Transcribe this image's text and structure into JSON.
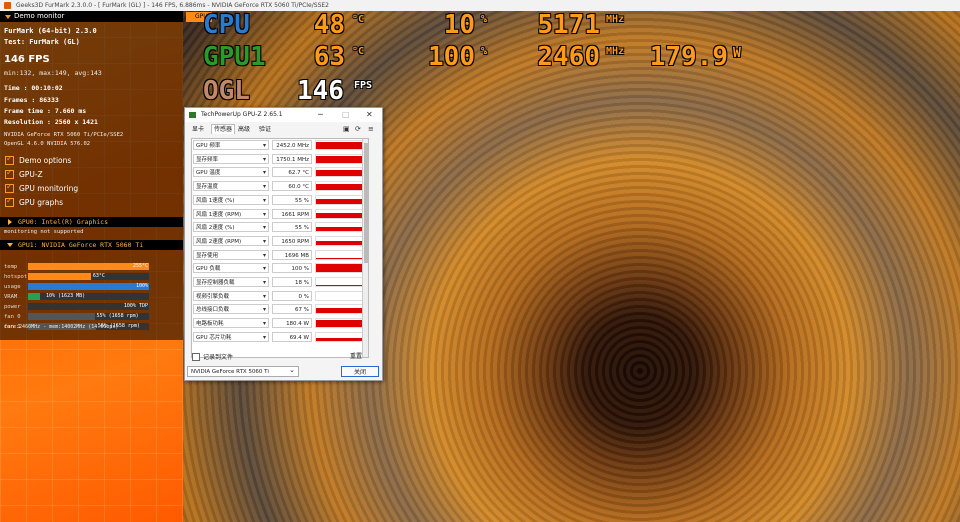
{
  "window": {
    "title": "Geeks3D FurMark 2.3.0.0 - [ FurMark (GL) ] - 146 FPS, 6.886ms - NVIDIA GeForce RTX 5060 Ti/PCIe/SSE2"
  },
  "monitor": {
    "header": "Demo monitor",
    "app": "FurMark (64-bit) 2.3.0",
    "test": "Test: FurMark (GL)",
    "fps": "146 FPS",
    "fps_stats": "min:132, max:149, avg:143",
    "time": "Time      : 00:10:02",
    "frames": "Frames    : 86333",
    "frame_time": "Frame time : 7.660 ms",
    "resolution": "Resolution : 2560 x 1421",
    "renderer": "NVIDIA GeForce RTX 5060 Ti/PCIe/SSE2",
    "opengl": "OpenGL 4.6.0 NVIDIA 576.02",
    "options": [
      "Demo options",
      "GPU-Z",
      "GPU monitoring",
      "GPU graphs"
    ],
    "gpu0": {
      "header": "GPU0: Intel(R) Graphics",
      "note": "monitoring not supported"
    },
    "gpu1": {
      "header": "GPU1: NVIDIA GeForce RTX 5060 Ti",
      "bars": [
        {
          "label": "temp",
          "value": "255°C",
          "fraction": 1.0,
          "color": "#ff8a1a"
        },
        {
          "label": "hotspot",
          "value": "63°C",
          "fraction": 0.52,
          "color": "#ff8a1a"
        },
        {
          "label": "usage",
          "value": "100%",
          "fraction": 1.0,
          "color": "#2a7ad0"
        },
        {
          "label": "VRAM",
          "value": "10% (1623 MB)",
          "fraction": 0.1,
          "color": "#2aa050"
        },
        {
          "label": "power",
          "value": "100% TDP",
          "fraction": 1.0,
          "color": "#333333"
        },
        {
          "label": "fan 0",
          "value": "55% (1658 rpm)",
          "fraction": 0.55,
          "color": "#555555"
        },
        {
          "label": "fan 1",
          "value": "56% (1658 rpm)",
          "fraction": 0.56,
          "color": "#555555"
        }
      ],
      "clocks": "core:2460MHz - mem:14002MHz (14.0Gbps)"
    }
  },
  "osd": {
    "tab": "GPU",
    "rows": [
      {
        "label": "CPU",
        "label_color": "#2a7ad0",
        "v1": "48",
        "u1": "°C",
        "v2": "10",
        "u2": "%",
        "v3": "5171",
        "u3": "MHz",
        "v4": "",
        "u4": ""
      },
      {
        "label": "GPU1",
        "label_color": "#2a9a2a",
        "v1": "63",
        "u1": "°C",
        "v2": "100",
        "u2": "%",
        "v3": "2460",
        "u3": "MHz",
        "v4": "179.9",
        "u4": "W"
      },
      {
        "label": "OGL",
        "label_color": "#c08a6a",
        "v1": "146",
        "u1": "FPS"
      }
    ]
  },
  "gpuz": {
    "title": "TechPowerUp GPU-Z 2.65.1",
    "tabs": [
      "显卡",
      "传感器",
      "高级",
      "验证"
    ],
    "active_tab": "传感器",
    "rows": [
      {
        "name": "GPU 频率",
        "value": "2452.0 MHz",
        "level": 0.9
      },
      {
        "name": "显存频率",
        "value": "1750.1 MHz",
        "level": 0.9
      },
      {
        "name": "GPU 温度",
        "value": "62.7 °C",
        "level": 0.8
      },
      {
        "name": "显存温度",
        "value": "60.0 °C",
        "level": 0.8
      },
      {
        "name": "风扇 1速度 (%)",
        "value": "55 %",
        "level": 0.55
      },
      {
        "name": "风扇 1速度 (RPM)",
        "value": "1661 RPM",
        "level": 0.55
      },
      {
        "name": "风扇 2速度 (%)",
        "value": "55 %",
        "level": 0.55
      },
      {
        "name": "风扇 2速度 (RPM)",
        "value": "1650 RPM",
        "level": 0.55
      },
      {
        "name": "显存使用",
        "value": "1696 MB",
        "level": 0.12
      },
      {
        "name": "GPU 负载",
        "value": "100 %",
        "level": 1.0
      },
      {
        "name": "显存控制器负载",
        "value": "18 %",
        "level": 0.18
      },
      {
        "name": "视频引擎负载",
        "value": "0 %",
        "level": 0.0
      },
      {
        "name": "总线接口负载",
        "value": "67 %",
        "level": 0.67
      },
      {
        "name": "电路板功耗",
        "value": "180.4 W",
        "level": 0.95
      },
      {
        "name": "GPU 芯片功耗",
        "value": "69.4 W",
        "level": 0.4
      }
    ],
    "log_label": "记录到文件",
    "reset_label": "重置",
    "device": "NVIDIA GeForce RTX 5060 Ti",
    "close_label": "关闭"
  }
}
